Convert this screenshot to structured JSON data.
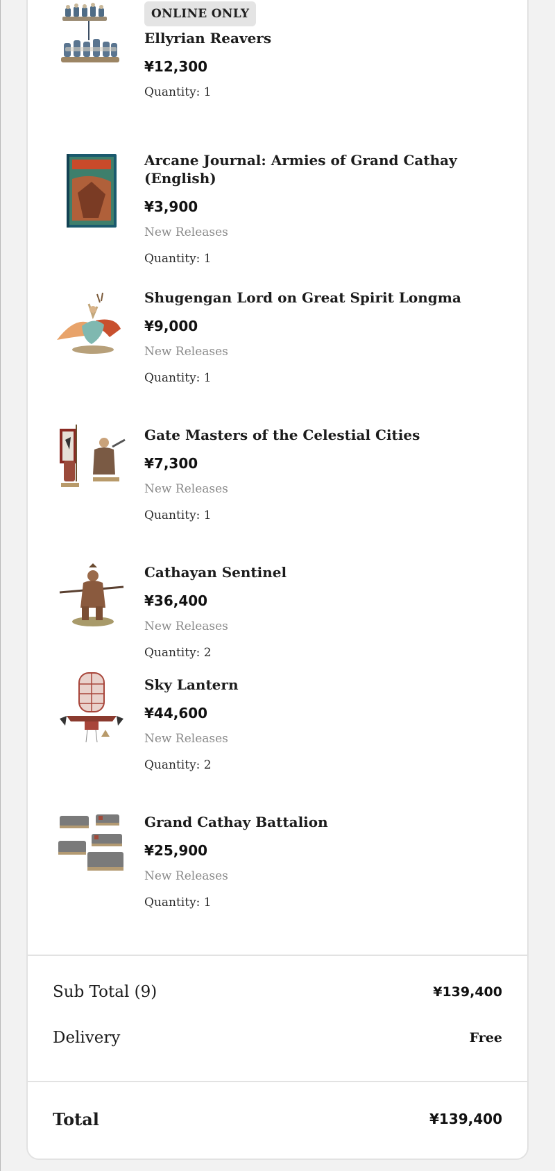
{
  "items": [
    {
      "badge": "ONLINE ONLY",
      "name": "Ellyrian Reavers",
      "price": "¥12,300",
      "category": "",
      "quantity": "Quantity: 1",
      "image_icon": "cavalry-regiment-thumbnail"
    },
    {
      "badge": "",
      "name": "Arcane Journal: Armies of Grand Cathay (English)",
      "price": "¥3,900",
      "category": "New Releases",
      "quantity": "Quantity: 1",
      "image_icon": "book-cover-thumbnail"
    },
    {
      "badge": "",
      "name": "Shugengan Lord on Great Spirit Longma",
      "price": "¥9,000",
      "category": "New Releases",
      "quantity": "Quantity: 1",
      "image_icon": "dragon-rider-thumbnail"
    },
    {
      "badge": "",
      "name": "Gate Masters of the Celestial Cities",
      "price": "¥7,300",
      "category": "New Releases",
      "quantity": "Quantity: 1",
      "image_icon": "banner-bearers-thumbnail"
    },
    {
      "badge": "",
      "name": "Cathayan Sentinel",
      "price": "¥36,400",
      "category": "New Releases",
      "quantity": "Quantity: 2",
      "image_icon": "warrior-statue-thumbnail"
    },
    {
      "badge": "",
      "name": "Sky Lantern",
      "price": "¥44,600",
      "category": "New Releases",
      "quantity": "Quantity: 2",
      "image_icon": "lantern-balloon-thumbnail"
    },
    {
      "badge": "",
      "name": "Grand Cathay Battalion",
      "price": "¥25,900",
      "category": "New Releases",
      "quantity": "Quantity: 1",
      "image_icon": "army-battalion-thumbnail"
    }
  ],
  "summary": {
    "subtotal_label": "Sub Total (9)",
    "subtotal_value": "¥139,400",
    "delivery_label": "Delivery",
    "delivery_value": "Free",
    "total_label": "Total",
    "total_value": "¥139,400"
  },
  "colors": {
    "background": "#f2f2f2",
    "card": "#ffffff",
    "badge": "#e4e4e4",
    "muted_text": "#8a8a8a"
  }
}
